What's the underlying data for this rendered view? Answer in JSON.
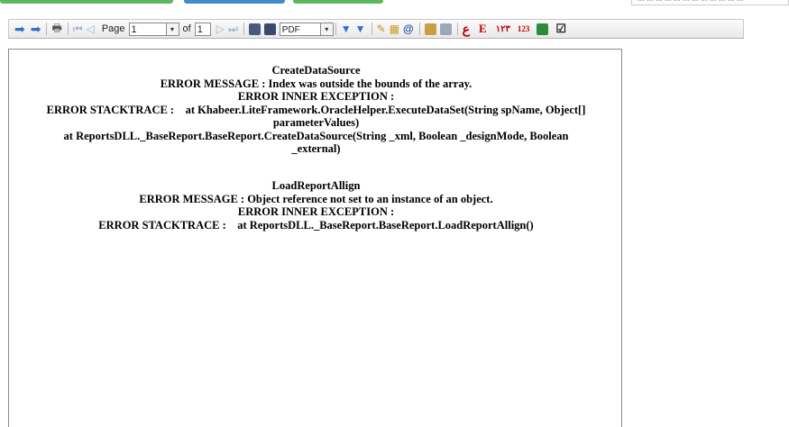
{
  "top": {
    "search_fragment": "... ... ...  ... ... ... ... ... ... ... ... ..."
  },
  "toolbar": {
    "page_label": "Page",
    "page_value": "1",
    "of_label": "of",
    "total_pages": "1",
    "export_format": "PDF",
    "icons": [
      "back-icon",
      "forward-icon",
      "print-icon",
      "first-page-icon",
      "previous-page-icon",
      "next-page-icon",
      "last-page-icon",
      "save-icon",
      "save-as-icon",
      "export-format-dropdown",
      "filter-icon",
      "clear-filter-icon",
      "edit-icon",
      "calendar-icon",
      "email-icon",
      "report-icon",
      "image-icon",
      "arabic-e-icon",
      "english-e-icon",
      "arabic-numerals-icon",
      "numbers-123-icon",
      "excel-icon",
      "checkbox-icon"
    ],
    "arabic_letter": "ع",
    "english_letter": "E",
    "arabic_numerals": "١٢٣",
    "numerals": "123"
  },
  "report": {
    "block1": {
      "title": "CreateDataSource",
      "message": "ERROR MESSAGE : Index was outside the bounds of the array.",
      "inner": "ERROR INNER EXCEPTION :",
      "stack_line1": "ERROR STACKTRACE :    at Khabeer.LiteFramework.OracleHelper.ExecuteDataSet(String spName, Object[]",
      "stack_line2": "parameterValues)",
      "stack_line3": "at ReportsDLL._BaseReport.BaseReport.CreateDataSource(String _xml, Boolean _designMode, Boolean",
      "stack_line4": "_external)"
    },
    "block2": {
      "title": "LoadReportAllign",
      "message": "ERROR MESSAGE : Object reference not set to an instance of an object.",
      "inner": "ERROR INNER EXCEPTION :",
      "stack_line1": "ERROR STACKTRACE :    at ReportsDLL._BaseReport.BaseReport.LoadReportAllign()"
    }
  }
}
